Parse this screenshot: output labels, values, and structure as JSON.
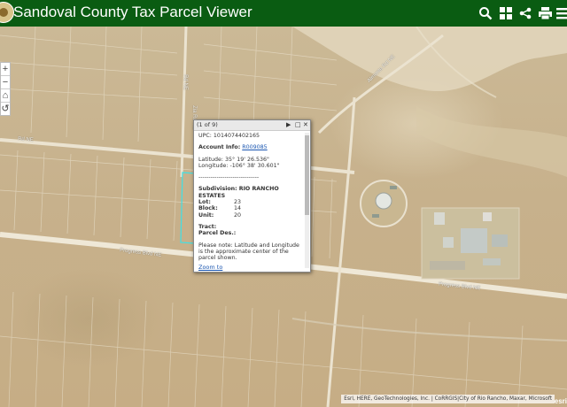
{
  "header": {
    "title": "Sandoval County Tax Parcel Viewer",
    "icons": [
      "search-icon",
      "grid-icon",
      "share-icon",
      "print-icon",
      "menu-icon"
    ],
    "bg_color": "#0a5c12"
  },
  "zoom_controls": {
    "zoom_in": "+",
    "zoom_out": "−",
    "home": "⌂",
    "locate": "↺"
  },
  "popup": {
    "counter": "(1 of 9)",
    "next_btn": "▶",
    "maximize_btn": "□",
    "close_btn": "✕",
    "upc": "UPC: 1014074402165",
    "account_label": "Account Info:",
    "account_value": "R009085",
    "latitude": "Latitude: 35° 19' 26.536\"",
    "longitude": "Longitude: -106° 38' 30.601\"",
    "separator": "------------------------------",
    "subdivision_label": "Subdivision:",
    "subdivision_value": "RIO RANCHO ESTATES",
    "lot_label": "Lot:",
    "lot_value": "23",
    "block_label": "Block:",
    "block_value": "14",
    "unit_label": "Unit:",
    "unit_value": "20",
    "tract_label": "Tract:",
    "parcel_des_label": "Parcel Des.:",
    "note": "Please note: Latitude and Longitude is the approximate center of the parcel shown.",
    "zoom_to": "Zoom to"
  },
  "road_labels": {
    "progress_left": "Progress Blvd NE",
    "progress_right": "Progress Blvd NE",
    "almonte": "Almonte Rd NE",
    "upper_road": "Rd NE",
    "vertical_rd": "Rd NE",
    "vertical_rd2": "Zia Rd NE"
  },
  "attribution": "Esri, HERE, GeoTechnologies, Inc. | CoRRGIS|City of Rio Rancho, Maxar, Microsoft",
  "esri_logo": "esri"
}
